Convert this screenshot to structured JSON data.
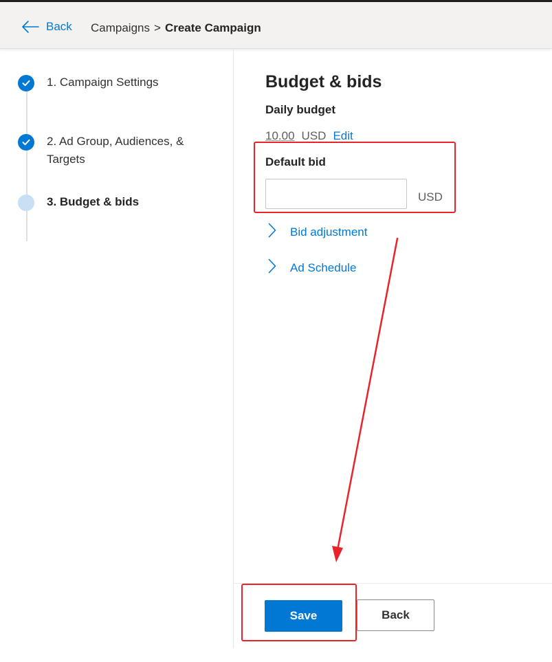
{
  "header": {
    "back_label": "Back",
    "breadcrumb": {
      "parent": "Campaigns",
      "separator": ">",
      "current": "Create Campaign"
    }
  },
  "steps": [
    {
      "label": "1. Campaign Settings",
      "status": "completed"
    },
    {
      "label": "2. Ad Group, Audiences, &",
      "label_line2": "Targets",
      "status": "completed"
    },
    {
      "label": "3. Budget & bids",
      "status": "current"
    }
  ],
  "main": {
    "title": "Budget & bids",
    "daily_budget": {
      "label": "Daily budget",
      "value": "10.00",
      "currency": "USD",
      "edit_label": "Edit"
    },
    "default_bid": {
      "label": "Default bid",
      "value": "",
      "currency": "USD"
    },
    "expanders": [
      {
        "label": "Bid adjustment"
      },
      {
        "label": "Ad Schedule"
      }
    ]
  },
  "footer": {
    "save_label": "Save",
    "back_label": "Back"
  },
  "colors": {
    "accent": "#0078d4",
    "annotation": "#e8232a"
  },
  "icons": {
    "back": "arrow-left-icon",
    "step_done": "checkmark-circle-icon",
    "step_current": "circle-icon",
    "expander": "chevron-right-icon"
  }
}
